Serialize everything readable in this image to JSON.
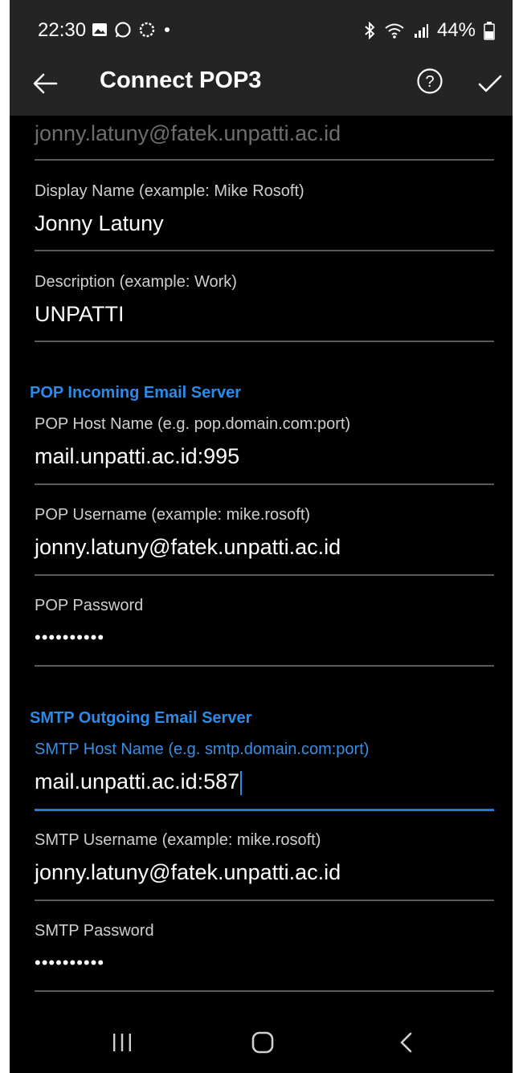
{
  "status": {
    "time": "22:30",
    "battery": "44%"
  },
  "appbar": {
    "title": "Connect POP3"
  },
  "top_value": "jonny.latuny@fatek.unpatti.ac.id",
  "fields": {
    "display_name": {
      "label": "Display Name (example: Mike Rosoft)",
      "value": "Jonny Latuny"
    },
    "description": {
      "label": "Description (example: Work)",
      "value": "UNPATTI"
    },
    "pop_host": {
      "label": "POP Host Name (e.g. pop.domain.com:port)",
      "value": "mail.unpatti.ac.id:995"
    },
    "pop_username": {
      "label": "POP Username (example: mike.rosoft)",
      "value": "jonny.latuny@fatek.unpatti.ac.id"
    },
    "pop_password": {
      "label": "POP Password",
      "value": "••••••••••"
    },
    "smtp_host": {
      "label": "SMTP Host Name (e.g. smtp.domain.com:port)",
      "value": "mail.unpatti.ac.id:587"
    },
    "smtp_username": {
      "label": "SMTP Username (example: mike.rosoft)",
      "value": "jonny.latuny@fatek.unpatti.ac.id"
    },
    "smtp_password": {
      "label": "SMTP Password",
      "value": "••••••••••"
    }
  },
  "sections": {
    "pop": "POP Incoming Email Server",
    "smtp": "SMTP Outgoing Email Server"
  },
  "icons": {
    "back": "arrow-left-icon",
    "help": "help-circle-icon",
    "confirm": "check-icon",
    "nav_recents": "recents-icon",
    "nav_home": "home-icon",
    "nav_back": "back-icon"
  },
  "colors": {
    "accent": "#2b8be8",
    "background": "#000000",
    "appbar": "#242424"
  }
}
